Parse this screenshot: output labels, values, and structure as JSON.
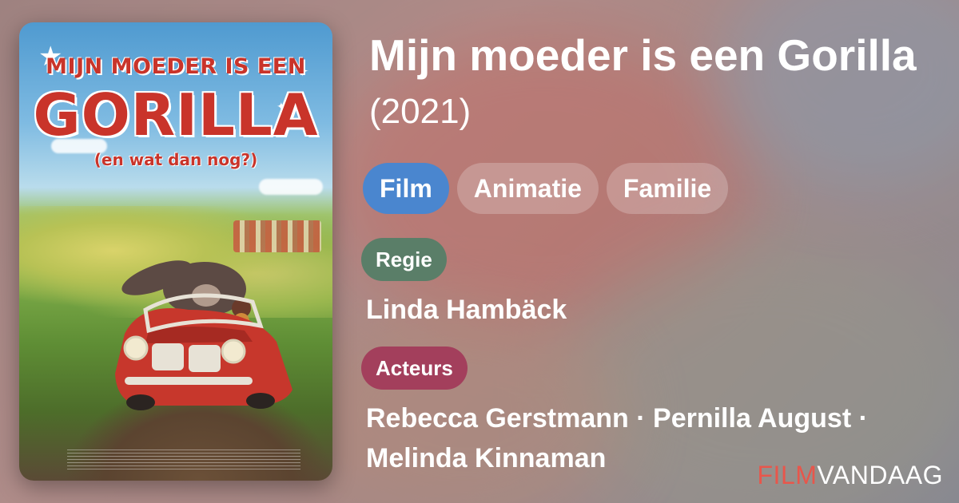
{
  "movie": {
    "title": "Mijn moeder is een Gorilla",
    "year": "(2021)"
  },
  "tags": [
    "Film",
    "Animatie",
    "Familie"
  ],
  "poster": {
    "title_top": "MIJN MOEDER IS EEN",
    "title_main": "GORILLA",
    "title_sub": "(en wat dan nog?)"
  },
  "sections": {
    "director_label": "Regie",
    "director": "Linda Hambäck",
    "actors_label": "Acteurs",
    "actors": "Rebecca Gerstmann · Pernilla August · Melinda Kinnaman"
  },
  "brand": {
    "part1": "FILM",
    "part2": "VANDAAG"
  },
  "colors": {
    "tag_primary": "#4a86cf",
    "regie_label": "#5a7e68",
    "acteurs_label": "#a33f5c",
    "brand_accent": "#e8564b"
  }
}
